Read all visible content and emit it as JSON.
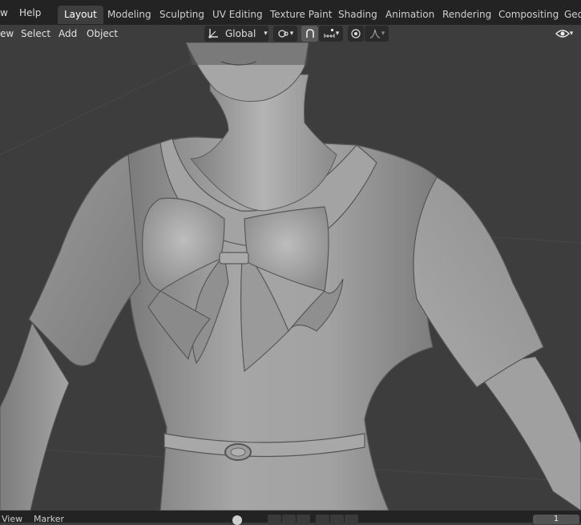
{
  "menubar": {
    "items": [
      "w",
      "Help"
    ]
  },
  "workspaces": {
    "tabs": [
      "Layout",
      "Modeling",
      "Sculpting",
      "UV Editing",
      "Texture Paint",
      "Shading",
      "Animation",
      "Rendering",
      "Compositing",
      "Geo"
    ],
    "active": "Layout"
  },
  "viewport_header": {
    "menus": [
      "ew",
      "Select",
      "Add",
      "Object"
    ],
    "transform_orientation": "Global",
    "icons": [
      "transform-orientation-icon",
      "pivot-point-icon",
      "snap-icon",
      "snap-increment-icon",
      "proportional-edit-icon",
      "falloff-curve-icon",
      "visibility-icon"
    ]
  },
  "timeline": {
    "menus": [
      "View",
      "Marker"
    ],
    "current_frame": "1"
  },
  "colors": {
    "topbar_bg": "#232323",
    "viewport_bg": "#3d3d3d",
    "active_tab_bg": "#3e3e3e",
    "mesh": "#9a9a9a"
  }
}
